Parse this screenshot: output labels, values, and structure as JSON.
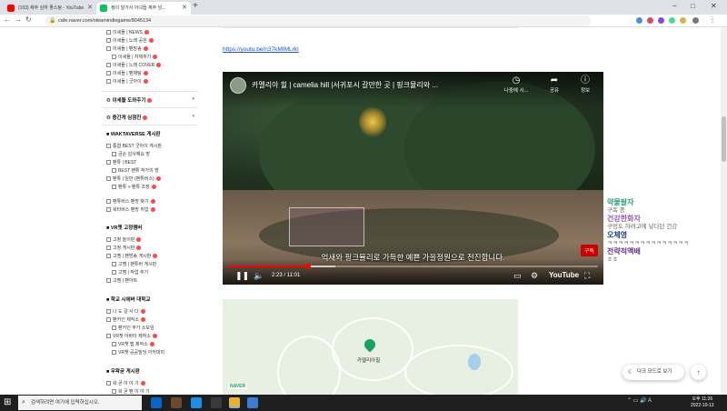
{
  "browser": {
    "tabs": [
      {
        "title": "(103) 제주 심하 좋스탕 - YouTube"
      },
      {
        "title": "정이 알가서 아녀듭 제주 넝..."
      }
    ],
    "url": "cafe.naver.com/steamindiegame/8045134",
    "window_controls": {
      "minimize": "−",
      "maximize": "□",
      "close": "✕"
    }
  },
  "sidebar": {
    "items": [
      {
        "label": "이세돌 | NEWS",
        "badge": true
      },
      {
        "label": "이세돌 | 노래 공원",
        "badge": true
      },
      {
        "label": "이세돌 | 팬방송",
        "badge": true
      },
      {
        "label": "이세돌 | 자체추가",
        "badge": true
      },
      {
        "label": "이세돌 | 노래 COVER",
        "badge": true
      },
      {
        "label": "이세돌 | 팬채팅",
        "badge": true
      },
      {
        "label": "이세돌 | 굿아이",
        "badge": true
      }
    ],
    "menu1": {
      "label": "이세돌 도와주기",
      "badge": true
    },
    "menu2": {
      "label": "충간게 심점진",
      "badge": true
    },
    "section_wakta": "WAKTAVERSE 게시판",
    "wakta_items": [
      {
        "label": "통합 BEST 굿아이 게시판"
      },
      {
        "label": "금손 감사해요 방"
      },
      {
        "label": "팬튜 | BEST"
      },
      {
        "label": "BEST 팬튜 작가의 방"
      },
      {
        "label": "팬튜 | 일반 (팬튜버스)"
      },
      {
        "label": "팬튜 + 팬튜 조장"
      },
      {
        "label": "팬튜버스 팬방 찾기"
      },
      {
        "label": "왁타버스 팬방 취업"
      }
    ],
    "section_vr": "VR챗 고정멤버",
    "vr_items": [
      {
        "label": "고정 놀이판"
      },
      {
        "label": "고정 게시판"
      },
      {
        "label": "고멤 | 팬방송 게시판"
      },
      {
        "label": "고멤 | 팬튜버 게시판"
      },
      {
        "label": "고멤 | 작업 추기"
      },
      {
        "label": "고멤 | 팬아트"
      }
    ],
    "section_school": "학교 시에버 대학교",
    "school_items": [
      {
        "label": "나 도 갈 사 다"
      },
      {
        "label": "팬카인 제작소"
      },
      {
        "label": "팬키인 추가 소모임"
      },
      {
        "label": "VR챗 아바타 제작소"
      },
      {
        "label": "VR챗 맵 제작소"
      },
      {
        "label": "VR챗 공공빌딩 아카데미"
      }
    ],
    "section_free": "우왁굳 게시판",
    "free_items": [
      {
        "label": "왁 굳 이 야 기"
      },
      {
        "label": "왁 굳 팬 이 야 기"
      }
    ]
  },
  "content": {
    "link": "https://youtu.be/n37kMIMLrkI",
    "video": {
      "title": "카멜리아 힐 | camelia hill |서귀포시 갈만한 곳 | 핑크뮬리와 ...",
      "later_label": "나중에 시...",
      "share_label": "공유",
      "info_label": "정보",
      "subtitle": "억새와 핑크뮬리로 가득한 예쁜 가을정원으로 전진합니다.",
      "subscribe": "구독",
      "time": "2:23 / 11:01",
      "progress": 0.216,
      "buffered": 0.29,
      "brand": "YouTube"
    },
    "map": {
      "place": "카멜리아힐",
      "brand": "NAVER"
    }
  },
  "chat": [
    {
      "user": "약물팔자",
      "msg": "구독 중",
      "color": "#2aa07a"
    },
    {
      "user": "건강한화자",
      "msg": "구멍도 하려고에 넣다던 건강",
      "color": "#9b59b6"
    },
    {
      "user": "오체영",
      "msg": "ㅋㅋㅋㅋㅋㅋㅋㅋㅋㅋㅋㅋㅋㅋㅋ",
      "color": "#1e3a8a"
    },
    {
      "user": "전략적액배",
      "msg": "ㅎㅎ",
      "color": "#6b2f8a"
    }
  ],
  "dark_mode_label": "다크 모드로 보기",
  "taskbar": {
    "search_placeholder": "검색하려면 여기에 입력하십시오.",
    "time": "오후 11:26",
    "date": "2022-10-13"
  }
}
